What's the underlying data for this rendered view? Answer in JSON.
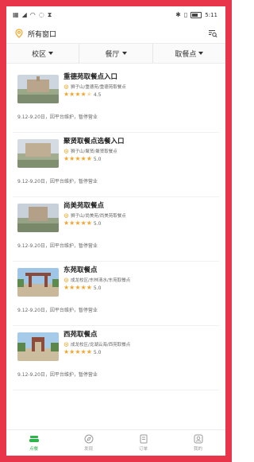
{
  "status_bar": {
    "left_icons": [
      "sim-icon",
      "signal-icon",
      "wifi-icon",
      "alarm-icon",
      "timer-icon"
    ],
    "time": "5:11"
  },
  "location_bar": {
    "label": "所有窗口"
  },
  "filters": [
    {
      "label": "校区"
    },
    {
      "label": "餐厅"
    },
    {
      "label": "取餐点"
    }
  ],
  "pickup_points": [
    {
      "name": "重德苑取餐点入口",
      "address": "狮子山/重德苑/重德苑取餐点",
      "rating": "4.5",
      "stars": 4.5,
      "notice": "9.12-9.20日，因平台维护，暂停营业"
    },
    {
      "name": "聚贤取餐点选餐入口",
      "address": "狮子山/聚贤/聚贤取餐点",
      "rating": "5.0",
      "stars": 5,
      "notice": "9.12-9.20日，因平台维护，暂停营业"
    },
    {
      "name": "尚美苑取餐点",
      "address": "狮子山/尚美苑/尚美苑取餐点",
      "rating": "5.0",
      "stars": 5,
      "notice": "9.12-9.20日，因平台维护，暂停营业"
    },
    {
      "name": "东苑取餐点",
      "address": "成龙校区/东林清水/东苑取餐点",
      "rating": "5.0",
      "stars": 5,
      "notice": "9.12-9.20日，因平台维护，暂停营业"
    },
    {
      "name": "西苑取餐点",
      "address": "成龙校区/龙湖云海/西苑取餐点",
      "rating": "5.0",
      "stars": 5,
      "notice": "9.12-9.20日，因平台维护，暂停营业"
    }
  ],
  "tabbar": [
    {
      "label": "点餐",
      "icon": "dish-icon",
      "active": true
    },
    {
      "label": "发现",
      "icon": "compass-icon",
      "active": false
    },
    {
      "label": "订单",
      "icon": "order-icon",
      "active": false
    },
    {
      "label": "我的",
      "icon": "profile-icon",
      "active": false
    }
  ],
  "colors": {
    "frame": "#e8354a",
    "accent": "#2bb54a",
    "star": "#f2a52b",
    "location": "#f5a623"
  }
}
